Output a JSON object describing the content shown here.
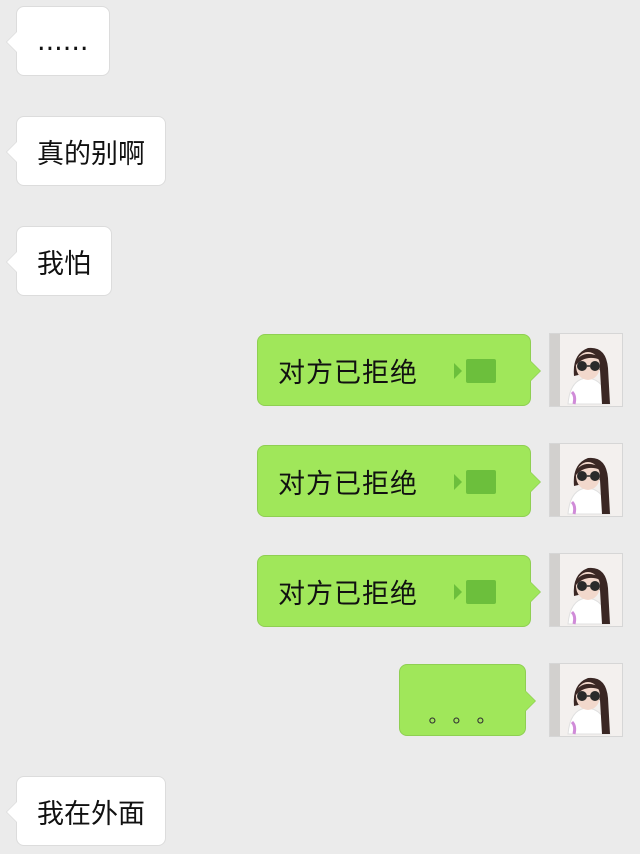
{
  "incoming": [
    {
      "text": "......"
    },
    {
      "text": "真的别啊"
    },
    {
      "text": "我怕"
    },
    {
      "text": "我在外面"
    }
  ],
  "outgoing": [
    {
      "text": "对方已拒绝",
      "icon": "video-call-icon"
    },
    {
      "text": "对方已拒绝",
      "icon": "video-call-icon"
    },
    {
      "text": "对方已拒绝",
      "icon": "video-call-icon"
    },
    {
      "text": "。。。"
    }
  ],
  "colors": {
    "background": "#ebebeb",
    "incoming_bubble": "#ffffff",
    "outgoing_bubble": "#a0e75a",
    "video_icon": "#6cbf3c"
  }
}
